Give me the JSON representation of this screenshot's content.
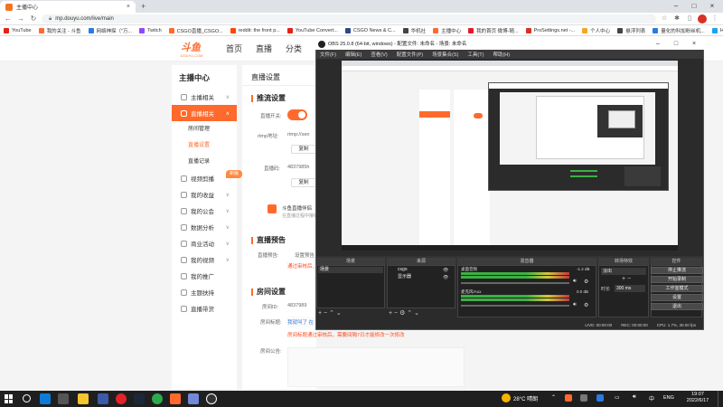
{
  "browser": {
    "tab_title": "主播中心",
    "new_tab": "+",
    "address": "mp.douyu.com/live/main",
    "bookmarks": [
      {
        "label": "YouTube",
        "color": "#e62117"
      },
      {
        "label": "我的关注 - 斗鱼",
        "color": "#ff6a2c"
      },
      {
        "label": "网络神探（\"万...",
        "color": "#2a7ae2"
      },
      {
        "label": "Twitch",
        "color": "#9146ff"
      },
      {
        "label": "CSGO直播_CSGO...",
        "color": "#ff6a2c"
      },
      {
        "label": "reddit: the front p...",
        "color": "#ff4500"
      },
      {
        "label": "YouTube Convert...",
        "color": "#e62117"
      },
      {
        "label": "CSGO News & C...",
        "color": "#2a4a8a"
      },
      {
        "label": "华机社",
        "color": "#444"
      },
      {
        "label": "主播中心",
        "color": "#ff6a2c"
      },
      {
        "label": "我的首页 微博-随...",
        "color": "#e6162d"
      },
      {
        "label": "ProSettings.net -...",
        "color": "#d93025"
      },
      {
        "label": "个人中心",
        "color": "#f5a623"
      },
      {
        "label": "悬浮列表",
        "color": "#444"
      },
      {
        "label": "量化的科加粉丝机...",
        "color": "#2a7ae2"
      },
      {
        "label": "Home / Twitter",
        "color": "#1da1f2"
      }
    ]
  },
  "site": {
    "logo_text": "斗鱼",
    "logo_sub": "DOUYU.COM",
    "nav": [
      "首页",
      "直播",
      "分类"
    ]
  },
  "sidebar": {
    "title": "主播中心",
    "items": [
      {
        "label": "主播相关"
      },
      {
        "label": "直播相关"
      },
      {
        "label": "视频剪播"
      },
      {
        "label": "我的收益"
      },
      {
        "label": "我的公会"
      },
      {
        "label": "数据分析"
      },
      {
        "label": "商业活动"
      },
      {
        "label": "我的视频"
      },
      {
        "label": "我的推广"
      },
      {
        "label": "主题扶持"
      },
      {
        "label": "直播带货"
      }
    ],
    "subitems": [
      "房间管理",
      "直播设置",
      "直播记录"
    ],
    "new_badge": "新版"
  },
  "content": {
    "header": "直播设置",
    "push_section": "推流设置",
    "live_switch_label": "直播开关:",
    "rtmp_label": "rtmp地址:",
    "rtmp_value": "rtmp://sen",
    "copy": "复制",
    "code_label": "直播码:",
    "code_value": "4837985h",
    "promo_line1": "斗鱼直播伴侣",
    "promo_line2": "在直播过程中接收",
    "preview_section": "直播预告",
    "preview_label": "直播预告:",
    "preview_value": "设置预告",
    "preview_note": "通过审核后,",
    "room_section": "房间设置",
    "room_id_label": "房间ID:",
    "room_id_value": "4837989",
    "room_name_label": "房间标题:",
    "room_name_value": "我就叫了 在",
    "room_name_note": "房间标题通过审核后，需要间隔7日才能修改一次修改",
    "room_notice_label": "房间公告:"
  },
  "obs": {
    "title": "OBS 25.0.8 (64-bit, windows) - 配置文件: 未命名 - 场景: 未命名",
    "menu": [
      "文件(F)",
      "编辑(E)",
      "查看(V)",
      "配置文件(P)",
      "场景集合(S)",
      "工具(T)",
      "帮助(H)"
    ],
    "scenes_header": "场景",
    "scenes": [
      "场景"
    ],
    "sources_header": "来源",
    "sources": [
      "csgo",
      "显示器"
    ],
    "mixer_header": "混音器",
    "mixer": [
      {
        "name": "桌面音频",
        "db": "-1.2 dB"
      },
      {
        "name": "麦克风/Aux",
        "db": "0.0 dB"
      }
    ],
    "transitions_header": "转场特效",
    "transition_type": "淡出",
    "duration_label": "时长",
    "duration_value": "300 ms",
    "controls_header": "控件",
    "controls": [
      "停止推流",
      "开始录制",
      "工作室模式",
      "设置",
      "退出"
    ],
    "status": [
      "LIVE: 00:00:00",
      "REC: 00:00:00",
      "CPU: 1.7%, 30.00 fps"
    ]
  },
  "taskbar": {
    "weather": "28°C 晴朗",
    "lang": "ENG",
    "time": "19:07",
    "date": "2022/6/17"
  }
}
